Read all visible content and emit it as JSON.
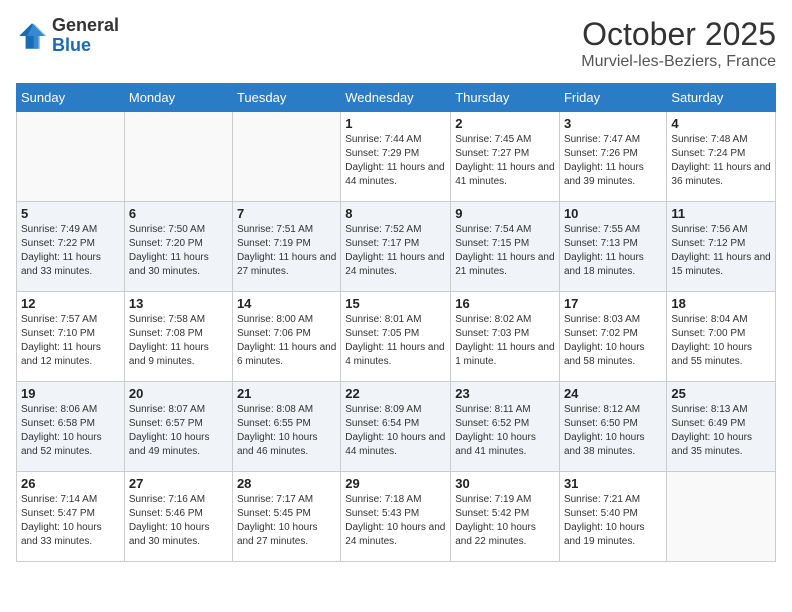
{
  "logo": {
    "general": "General",
    "blue": "Blue"
  },
  "header": {
    "month": "October 2025",
    "location": "Murviel-les-Beziers, France"
  },
  "weekdays": [
    "Sunday",
    "Monday",
    "Tuesday",
    "Wednesday",
    "Thursday",
    "Friday",
    "Saturday"
  ],
  "weeks": [
    [
      {
        "day": "",
        "info": ""
      },
      {
        "day": "",
        "info": ""
      },
      {
        "day": "",
        "info": ""
      },
      {
        "day": "1",
        "info": "Sunrise: 7:44 AM\nSunset: 7:29 PM\nDaylight: 11 hours\nand 44 minutes."
      },
      {
        "day": "2",
        "info": "Sunrise: 7:45 AM\nSunset: 7:27 PM\nDaylight: 11 hours\nand 41 minutes."
      },
      {
        "day": "3",
        "info": "Sunrise: 7:47 AM\nSunset: 7:26 PM\nDaylight: 11 hours\nand 39 minutes."
      },
      {
        "day": "4",
        "info": "Sunrise: 7:48 AM\nSunset: 7:24 PM\nDaylight: 11 hours\nand 36 minutes."
      }
    ],
    [
      {
        "day": "5",
        "info": "Sunrise: 7:49 AM\nSunset: 7:22 PM\nDaylight: 11 hours\nand 33 minutes."
      },
      {
        "day": "6",
        "info": "Sunrise: 7:50 AM\nSunset: 7:20 PM\nDaylight: 11 hours\nand 30 minutes."
      },
      {
        "day": "7",
        "info": "Sunrise: 7:51 AM\nSunset: 7:19 PM\nDaylight: 11 hours\nand 27 minutes."
      },
      {
        "day": "8",
        "info": "Sunrise: 7:52 AM\nSunset: 7:17 PM\nDaylight: 11 hours\nand 24 minutes."
      },
      {
        "day": "9",
        "info": "Sunrise: 7:54 AM\nSunset: 7:15 PM\nDaylight: 11 hours\nand 21 minutes."
      },
      {
        "day": "10",
        "info": "Sunrise: 7:55 AM\nSunset: 7:13 PM\nDaylight: 11 hours\nand 18 minutes."
      },
      {
        "day": "11",
        "info": "Sunrise: 7:56 AM\nSunset: 7:12 PM\nDaylight: 11 hours\nand 15 minutes."
      }
    ],
    [
      {
        "day": "12",
        "info": "Sunrise: 7:57 AM\nSunset: 7:10 PM\nDaylight: 11 hours\nand 12 minutes."
      },
      {
        "day": "13",
        "info": "Sunrise: 7:58 AM\nSunset: 7:08 PM\nDaylight: 11 hours\nand 9 minutes."
      },
      {
        "day": "14",
        "info": "Sunrise: 8:00 AM\nSunset: 7:06 PM\nDaylight: 11 hours\nand 6 minutes."
      },
      {
        "day": "15",
        "info": "Sunrise: 8:01 AM\nSunset: 7:05 PM\nDaylight: 11 hours\nand 4 minutes."
      },
      {
        "day": "16",
        "info": "Sunrise: 8:02 AM\nSunset: 7:03 PM\nDaylight: 11 hours\nand 1 minute."
      },
      {
        "day": "17",
        "info": "Sunrise: 8:03 AM\nSunset: 7:02 PM\nDaylight: 10 hours\nand 58 minutes."
      },
      {
        "day": "18",
        "info": "Sunrise: 8:04 AM\nSunset: 7:00 PM\nDaylight: 10 hours\nand 55 minutes."
      }
    ],
    [
      {
        "day": "19",
        "info": "Sunrise: 8:06 AM\nSunset: 6:58 PM\nDaylight: 10 hours\nand 52 minutes."
      },
      {
        "day": "20",
        "info": "Sunrise: 8:07 AM\nSunset: 6:57 PM\nDaylight: 10 hours\nand 49 minutes."
      },
      {
        "day": "21",
        "info": "Sunrise: 8:08 AM\nSunset: 6:55 PM\nDaylight: 10 hours\nand 46 minutes."
      },
      {
        "day": "22",
        "info": "Sunrise: 8:09 AM\nSunset: 6:54 PM\nDaylight: 10 hours\nand 44 minutes."
      },
      {
        "day": "23",
        "info": "Sunrise: 8:11 AM\nSunset: 6:52 PM\nDaylight: 10 hours\nand 41 minutes."
      },
      {
        "day": "24",
        "info": "Sunrise: 8:12 AM\nSunset: 6:50 PM\nDaylight: 10 hours\nand 38 minutes."
      },
      {
        "day": "25",
        "info": "Sunrise: 8:13 AM\nSunset: 6:49 PM\nDaylight: 10 hours\nand 35 minutes."
      }
    ],
    [
      {
        "day": "26",
        "info": "Sunrise: 7:14 AM\nSunset: 5:47 PM\nDaylight: 10 hours\nand 33 minutes."
      },
      {
        "day": "27",
        "info": "Sunrise: 7:16 AM\nSunset: 5:46 PM\nDaylight: 10 hours\nand 30 minutes."
      },
      {
        "day": "28",
        "info": "Sunrise: 7:17 AM\nSunset: 5:45 PM\nDaylight: 10 hours\nand 27 minutes."
      },
      {
        "day": "29",
        "info": "Sunrise: 7:18 AM\nSunset: 5:43 PM\nDaylight: 10 hours\nand 24 minutes."
      },
      {
        "day": "30",
        "info": "Sunrise: 7:19 AM\nSunset: 5:42 PM\nDaylight: 10 hours\nand 22 minutes."
      },
      {
        "day": "31",
        "info": "Sunrise: 7:21 AM\nSunset: 5:40 PM\nDaylight: 10 hours\nand 19 minutes."
      },
      {
        "day": "",
        "info": ""
      }
    ]
  ]
}
